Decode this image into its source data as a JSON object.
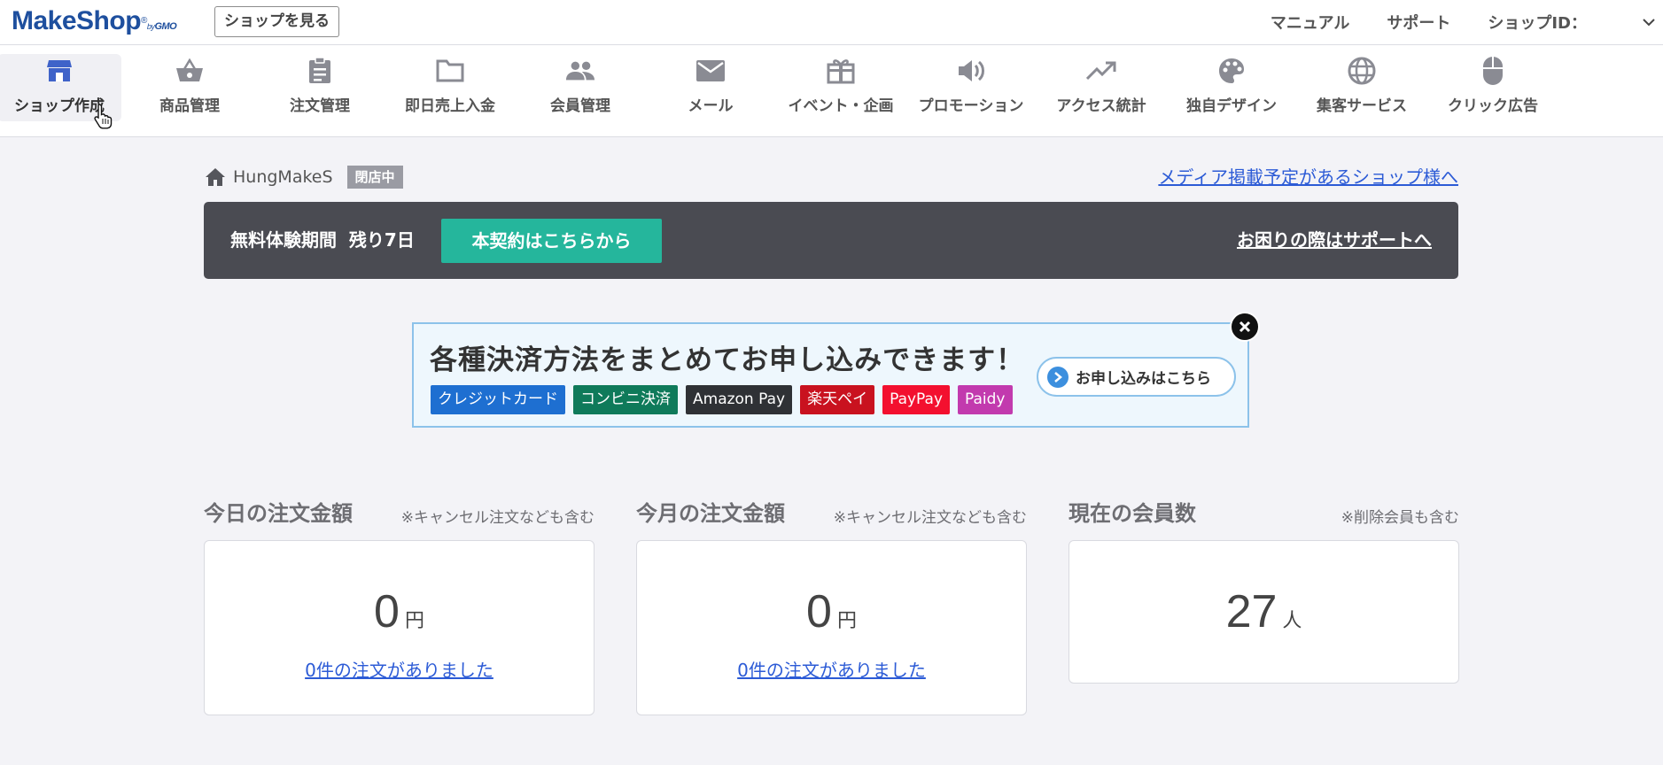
{
  "header": {
    "logo": {
      "make": "Make",
      "shop": "Shop",
      "reg": "®",
      "by": "by",
      "gmo": "GMO"
    },
    "view_shop": "ショップを見る",
    "links": [
      "マニュアル",
      "サポート"
    ],
    "shop_id_label": "ショップID："
  },
  "nav": [
    {
      "label": "ショップ作成",
      "icon": "storefront-icon"
    },
    {
      "label": "商品管理",
      "icon": "basket-icon"
    },
    {
      "label": "注文管理",
      "icon": "clipboard-icon"
    },
    {
      "label": "即日売上入金",
      "icon": "folder-icon"
    },
    {
      "label": "会員管理",
      "icon": "people-icon"
    },
    {
      "label": "メール",
      "icon": "mail-icon"
    },
    {
      "label": "イベント・企画",
      "icon": "gift-icon"
    },
    {
      "label": "プロモーション",
      "icon": "speaker-icon"
    },
    {
      "label": "アクセス統計",
      "icon": "trending-up-icon"
    },
    {
      "label": "独自デザイン",
      "icon": "palette-icon"
    },
    {
      "label": "集客サービス",
      "icon": "globe-icon"
    },
    {
      "label": "クリック広告",
      "icon": "mouse-icon"
    }
  ],
  "breadcrumb": {
    "shop_name": "HungMakeS",
    "status": "閉店中"
  },
  "media_link": "メディア掲載予定があるショップ様へ",
  "trial": {
    "days_text": "無料体験期間  残り7日",
    "contract_button": "本契約はこちらから",
    "support_link": "お困りの際はサポートへ"
  },
  "payment_banner": {
    "headline": "各種決済方法をまとめてお申し込みできます！",
    "methods": [
      {
        "label": "クレジットカード",
        "color": "#1e6fd1"
      },
      {
        "label": "コンビニ決済",
        "color": "#0f7a5a"
      },
      {
        "label": "Amazon Pay",
        "color": "#2f3135"
      },
      {
        "label": "楽天ペイ",
        "color": "#c9121f"
      },
      {
        "label": "PayPay",
        "color": "#f3102f"
      },
      {
        "label": "Paidy",
        "color": "#c23aae"
      }
    ],
    "apply_button": "お申し込みはこちら"
  },
  "stats": [
    {
      "title": "今日の注文金額",
      "note": "※キャンセル注文なども含む",
      "value": "0",
      "unit": "円",
      "orders_link": "0件の注文がありました"
    },
    {
      "title": "今月の注文金額",
      "note": "※キャンセル注文なども含む",
      "value": "0",
      "unit": "円",
      "orders_link": "0件の注文がありました"
    },
    {
      "title": "現在の会員数",
      "note": "※削除会員も含む",
      "value": "27",
      "unit": "人"
    }
  ],
  "colors": {
    "accent": "#25b69c",
    "link": "#2c5bd6",
    "banner_dark": "#4a4b52",
    "nav_active": "#3f63c9"
  }
}
